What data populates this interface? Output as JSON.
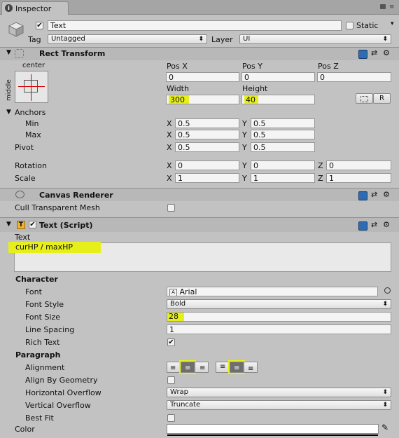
{
  "window": {
    "tab_title": "Inspector"
  },
  "gameobject": {
    "name": "Text",
    "static_label": "Static",
    "tag_label": "Tag",
    "tag_value": "Untagged",
    "layer_label": "Layer",
    "layer_value": "UI"
  },
  "rect_transform": {
    "title": "Rect Transform",
    "anchor_preset_top": "center",
    "anchor_preset_side": "middle",
    "pos_x_label": "Pos X",
    "pos_y_label": "Pos Y",
    "pos_z_label": "Pos Z",
    "pos_x": "0",
    "pos_y": "0",
    "pos_z": "0",
    "width_label": "Width",
    "height_label": "Height",
    "width": "300",
    "height": "40",
    "r_button": "R",
    "anchors_label": "Anchors",
    "min_label": "Min",
    "max_label": "Max",
    "min_x": "0.5",
    "min_y": "0.5",
    "max_x": "0.5",
    "max_y": "0.5",
    "pivot_label": "Pivot",
    "pivot_x": "0.5",
    "pivot_y": "0.5",
    "rotation_label": "Rotation",
    "rot_x": "0",
    "rot_y": "0",
    "rot_z": "0",
    "scale_label": "Scale",
    "scale_x": "1",
    "scale_y": "1",
    "scale_z": "1",
    "x": "X",
    "y": "Y",
    "z": "Z"
  },
  "canvas_renderer": {
    "title": "Canvas Renderer",
    "cull_label": "Cull Transparent Mesh"
  },
  "text_script": {
    "title": "Text (Script)",
    "text_label": "Text",
    "text_value": "curHP / maxHP",
    "character_header": "Character",
    "font_label": "Font",
    "font_value": "Arial",
    "font_style_label": "Font Style",
    "font_style_value": "Bold",
    "font_size_label": "Font Size",
    "font_size_value": "28",
    "line_spacing_label": "Line Spacing",
    "line_spacing_value": "1",
    "rich_text_label": "Rich Text",
    "paragraph_header": "Paragraph",
    "alignment_label": "Alignment",
    "align_geometry_label": "Align By Geometry",
    "h_overflow_label": "Horizontal Overflow",
    "h_overflow_value": "Wrap",
    "v_overflow_label": "Vertical Overflow",
    "v_overflow_value": "Truncate",
    "best_fit_label": "Best Fit",
    "color_label": "Color"
  },
  "colors": {
    "highlight": "#e7ef1a",
    "panel": "#c2c2c2",
    "anchor_red": "#d00000"
  }
}
